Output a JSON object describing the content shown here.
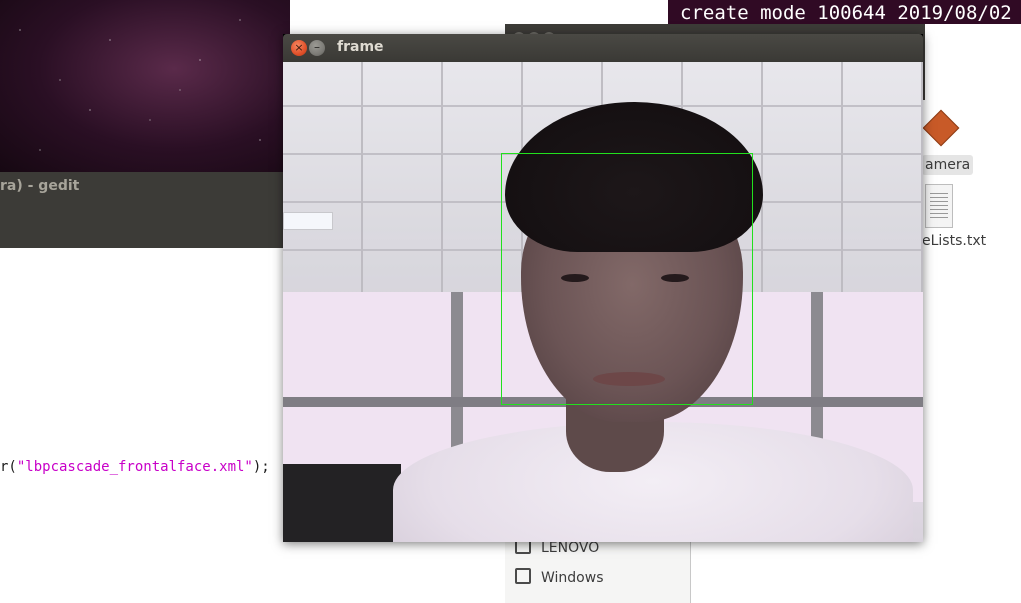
{
  "terminal": {
    "text": "create mode 100644 2019/08/02"
  },
  "gedit": {
    "title_fragment": "ra) - gedit",
    "code_prefix": "r(",
    "code_string": "\"lbpcascade_frontalface.xml\"",
    "code_suffix": ");"
  },
  "files": {
    "icons": [
      {
        "label": "amera",
        "icon": "camera-folder-icon"
      },
      {
        "label": "eLists.txt",
        "icon": "text-file-icon"
      }
    ],
    "sidebar": [
      {
        "label": "LENOVO",
        "icon": "drive-icon"
      },
      {
        "label": "Windows",
        "icon": "drive-icon"
      }
    ]
  },
  "frame_window": {
    "title": "frame",
    "close_glyph": "×",
    "minimize_glyph": "–",
    "detection_color": "#22e01e"
  }
}
